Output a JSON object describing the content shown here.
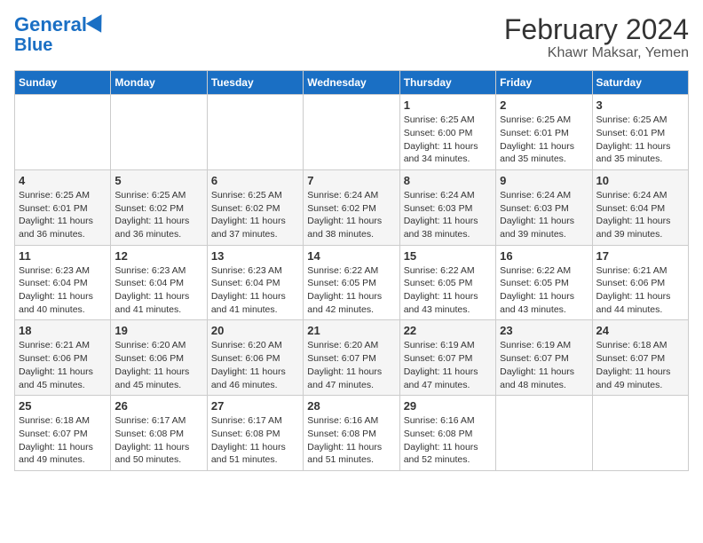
{
  "header": {
    "logo_line1": "General",
    "logo_line2": "Blue",
    "title": "February 2024",
    "subtitle": "Khawr Maksar, Yemen"
  },
  "days_of_week": [
    "Sunday",
    "Monday",
    "Tuesday",
    "Wednesday",
    "Thursday",
    "Friday",
    "Saturday"
  ],
  "weeks": [
    [
      {
        "day": "",
        "info": ""
      },
      {
        "day": "",
        "info": ""
      },
      {
        "day": "",
        "info": ""
      },
      {
        "day": "",
        "info": ""
      },
      {
        "day": "1",
        "info": "Sunrise: 6:25 AM\nSunset: 6:00 PM\nDaylight: 11 hours and 34 minutes."
      },
      {
        "day": "2",
        "info": "Sunrise: 6:25 AM\nSunset: 6:01 PM\nDaylight: 11 hours and 35 minutes."
      },
      {
        "day": "3",
        "info": "Sunrise: 6:25 AM\nSunset: 6:01 PM\nDaylight: 11 hours and 35 minutes."
      }
    ],
    [
      {
        "day": "4",
        "info": "Sunrise: 6:25 AM\nSunset: 6:01 PM\nDaylight: 11 hours and 36 minutes."
      },
      {
        "day": "5",
        "info": "Sunrise: 6:25 AM\nSunset: 6:02 PM\nDaylight: 11 hours and 36 minutes."
      },
      {
        "day": "6",
        "info": "Sunrise: 6:25 AM\nSunset: 6:02 PM\nDaylight: 11 hours and 37 minutes."
      },
      {
        "day": "7",
        "info": "Sunrise: 6:24 AM\nSunset: 6:02 PM\nDaylight: 11 hours and 38 minutes."
      },
      {
        "day": "8",
        "info": "Sunrise: 6:24 AM\nSunset: 6:03 PM\nDaylight: 11 hours and 38 minutes."
      },
      {
        "day": "9",
        "info": "Sunrise: 6:24 AM\nSunset: 6:03 PM\nDaylight: 11 hours and 39 minutes."
      },
      {
        "day": "10",
        "info": "Sunrise: 6:24 AM\nSunset: 6:04 PM\nDaylight: 11 hours and 39 minutes."
      }
    ],
    [
      {
        "day": "11",
        "info": "Sunrise: 6:23 AM\nSunset: 6:04 PM\nDaylight: 11 hours and 40 minutes."
      },
      {
        "day": "12",
        "info": "Sunrise: 6:23 AM\nSunset: 6:04 PM\nDaylight: 11 hours and 41 minutes."
      },
      {
        "day": "13",
        "info": "Sunrise: 6:23 AM\nSunset: 6:04 PM\nDaylight: 11 hours and 41 minutes."
      },
      {
        "day": "14",
        "info": "Sunrise: 6:22 AM\nSunset: 6:05 PM\nDaylight: 11 hours and 42 minutes."
      },
      {
        "day": "15",
        "info": "Sunrise: 6:22 AM\nSunset: 6:05 PM\nDaylight: 11 hours and 43 minutes."
      },
      {
        "day": "16",
        "info": "Sunrise: 6:22 AM\nSunset: 6:05 PM\nDaylight: 11 hours and 43 minutes."
      },
      {
        "day": "17",
        "info": "Sunrise: 6:21 AM\nSunset: 6:06 PM\nDaylight: 11 hours and 44 minutes."
      }
    ],
    [
      {
        "day": "18",
        "info": "Sunrise: 6:21 AM\nSunset: 6:06 PM\nDaylight: 11 hours and 45 minutes."
      },
      {
        "day": "19",
        "info": "Sunrise: 6:20 AM\nSunset: 6:06 PM\nDaylight: 11 hours and 45 minutes."
      },
      {
        "day": "20",
        "info": "Sunrise: 6:20 AM\nSunset: 6:06 PM\nDaylight: 11 hours and 46 minutes."
      },
      {
        "day": "21",
        "info": "Sunrise: 6:20 AM\nSunset: 6:07 PM\nDaylight: 11 hours and 47 minutes."
      },
      {
        "day": "22",
        "info": "Sunrise: 6:19 AM\nSunset: 6:07 PM\nDaylight: 11 hours and 47 minutes."
      },
      {
        "day": "23",
        "info": "Sunrise: 6:19 AM\nSunset: 6:07 PM\nDaylight: 11 hours and 48 minutes."
      },
      {
        "day": "24",
        "info": "Sunrise: 6:18 AM\nSunset: 6:07 PM\nDaylight: 11 hours and 49 minutes."
      }
    ],
    [
      {
        "day": "25",
        "info": "Sunrise: 6:18 AM\nSunset: 6:07 PM\nDaylight: 11 hours and 49 minutes."
      },
      {
        "day": "26",
        "info": "Sunrise: 6:17 AM\nSunset: 6:08 PM\nDaylight: 11 hours and 50 minutes."
      },
      {
        "day": "27",
        "info": "Sunrise: 6:17 AM\nSunset: 6:08 PM\nDaylight: 11 hours and 51 minutes."
      },
      {
        "day": "28",
        "info": "Sunrise: 6:16 AM\nSunset: 6:08 PM\nDaylight: 11 hours and 51 minutes."
      },
      {
        "day": "29",
        "info": "Sunrise: 6:16 AM\nSunset: 6:08 PM\nDaylight: 11 hours and 52 minutes."
      },
      {
        "day": "",
        "info": ""
      },
      {
        "day": "",
        "info": ""
      }
    ]
  ]
}
